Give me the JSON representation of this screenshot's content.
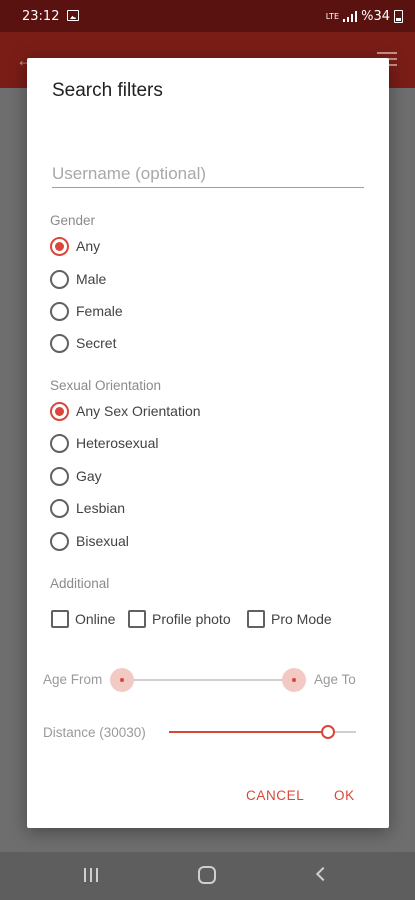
{
  "status_bar": {
    "time": "23:12",
    "network": "LTE",
    "battery_text": "%34"
  },
  "dialog": {
    "title": "Search filters",
    "username_placeholder": "Username (optional)",
    "gender": {
      "label": "Gender",
      "options": [
        "Any",
        "Male",
        "Female",
        "Secret"
      ],
      "selected": "Any"
    },
    "orientation": {
      "label": "Sexual Orientation",
      "options": [
        "Any Sex Orientation",
        "Heterosexual",
        "Gay",
        "Lesbian",
        "Bisexual"
      ],
      "selected": "Any Sex Orientation"
    },
    "additional": {
      "label": "Additional",
      "options": [
        "Online",
        "Profile photo",
        "Pro Mode"
      ]
    },
    "age": {
      "from_label": "Age From",
      "to_label": "Age To"
    },
    "distance": {
      "label": "Distance (30030)",
      "value": 30030
    },
    "buttons": {
      "cancel": "CANCEL",
      "ok": "OK"
    }
  },
  "colors": {
    "accent": "#d9473a",
    "status_bar": "#5a1210",
    "scrim": "#6e6e6e"
  },
  "icons": [
    "image-icon",
    "signal-icon",
    "battery-icon",
    "back-arrow-icon",
    "filter-icon",
    "recent-apps-icon",
    "home-icon",
    "nav-back-icon"
  ]
}
